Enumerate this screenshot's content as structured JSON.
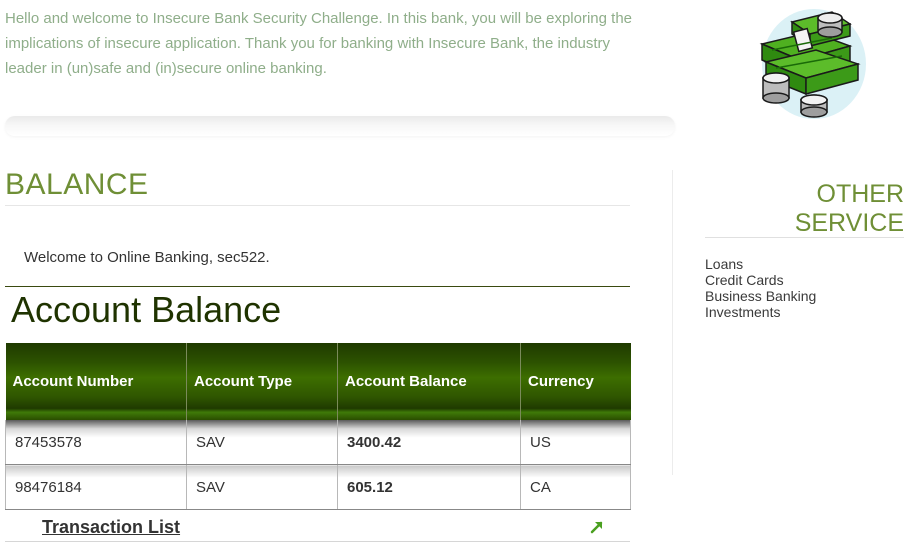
{
  "intro": {
    "text": "Hello and welcome to Insecure Bank Security Challenge. In this bank, you will be exploring the implications of insecure application. Thank you for banking with Insecure Bank, the industry leader in (un)safe and (in)secure online banking."
  },
  "illustration": {
    "icon": "money-stack-icon"
  },
  "balance": {
    "section_title": "BALANCE",
    "welcome": "Welcome to Online Banking, sec522.",
    "heading": "Account Balance",
    "columns": [
      "Account Number",
      "Account Type",
      "Account Balance",
      "Currency"
    ],
    "rows": [
      {
        "number": "87453578",
        "type": "SAV",
        "balance": "3400.42",
        "currency": "US"
      },
      {
        "number": "98476184",
        "type": "SAV",
        "balance": "605.12",
        "currency": "CA"
      }
    ],
    "transaction_link": "Transaction List",
    "transaction_icon": "external-arrow-icon"
  },
  "other_service": {
    "title": "OTHER SERVICE",
    "items": [
      "Loans",
      "Credit Cards",
      "Business Banking",
      "Investments"
    ]
  },
  "colors": {
    "accent_green": "#6f8f36",
    "header_green": "#2c5200",
    "intro_text": "#8fae8a"
  }
}
